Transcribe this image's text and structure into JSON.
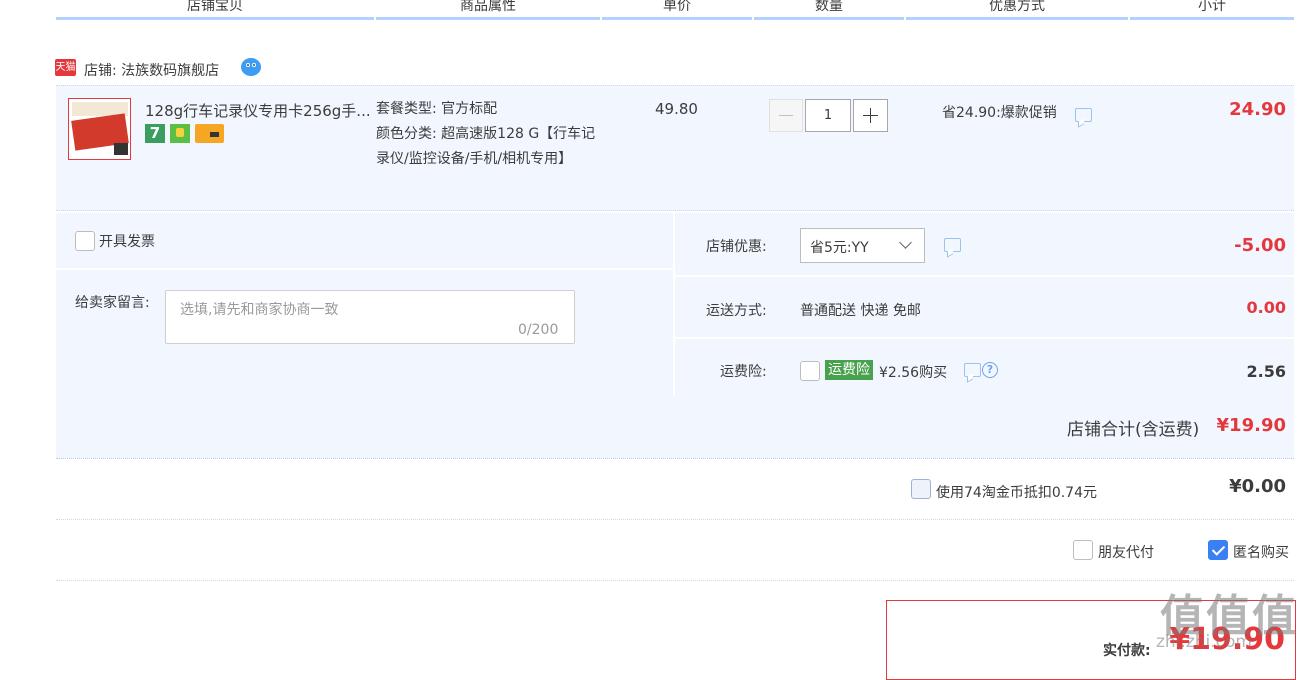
{
  "header": {
    "col_item": "店铺宝贝",
    "col_attr": "商品属性",
    "col_price": "单价",
    "col_qty": "数量",
    "col_discount": "优惠方式",
    "col_subtotal": "小计"
  },
  "shop": {
    "badge": "天猫",
    "name": "店铺: 法族数码旗舰店"
  },
  "item": {
    "title": "128g行车记录仪专用卡256g手...",
    "service_badge_7": "7",
    "attr_package": "套餐类型: 官方标配",
    "attr_color": "颜色分类: 超高速版128 G【行车记录仪/监控设备/手机/相机专用】",
    "unit_price": "49.80",
    "quantity": "1",
    "promo": "省24.90:爆款促销",
    "subtotal": "24.90"
  },
  "invoice": {
    "label": "开具发票"
  },
  "message": {
    "label": "给卖家留言:",
    "placeholder": "选填,请先和商家协商一致",
    "count": "0/200"
  },
  "shop_discount": {
    "label": "店铺优惠:",
    "selected": "省5元:YY",
    "amount": "-5.00"
  },
  "shipping": {
    "label": "运送方式:",
    "value": "普通配送 快递 免邮",
    "amount": "0.00"
  },
  "insurance": {
    "label": "运费险:",
    "tag": "运费险",
    "desc": "¥2.56购买",
    "amount": "2.56"
  },
  "shop_total": {
    "label": "店铺合计(含运费)",
    "amount": "¥19.90"
  },
  "coins": {
    "label": "使用74淘金币抵扣0.74元",
    "amount": "¥0.00"
  },
  "options": {
    "friend_pay": "朋友代付",
    "anonymous": "匿名购买"
  },
  "payment": {
    "label": "实付款:",
    "amount": "¥19.90"
  },
  "watermark": {
    "main": "值值值",
    "sub": "zhi.zhi.com"
  },
  "colors": {
    "accent_red": "#e4393c",
    "row_bg": "#f2f7ff",
    "header_line": "#b2d1ff",
    "insurance_green": "#48a14d",
    "checkbox_blue": "#3b7ff5"
  }
}
